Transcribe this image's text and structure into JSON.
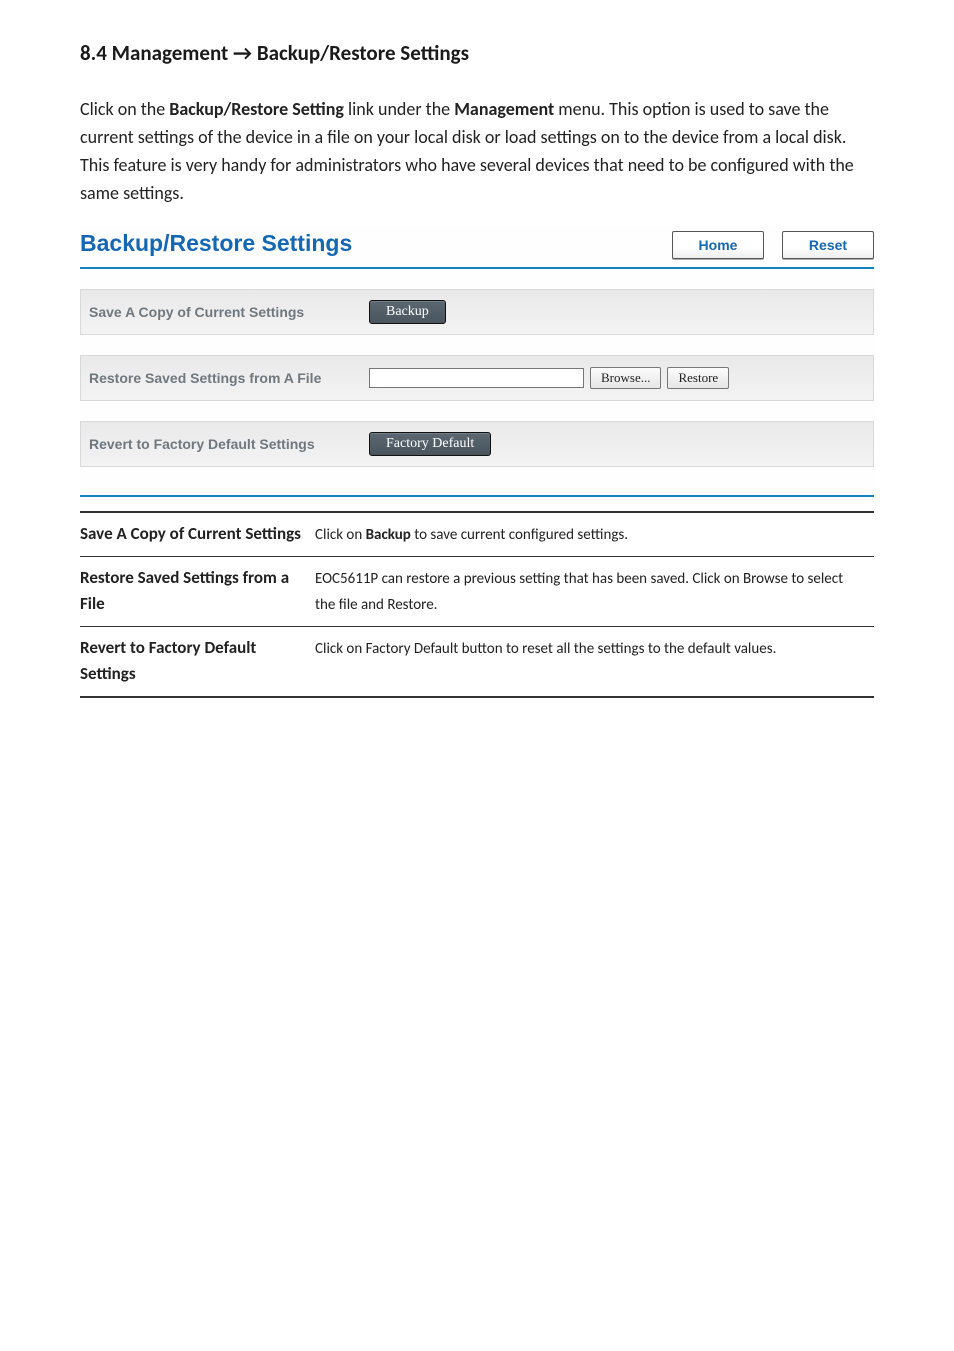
{
  "section_heading": "8.4 Management → Backup/Restore Settings",
  "intro": {
    "pre1": "Click on the ",
    "bold1": "Backup/Restore Setting",
    "mid1": " link under the ",
    "bold2": "Management",
    "post1": " menu. This option is used to save the current settings of the device in a file on your local disk or load settings on to the device from a local disk. This feature is very handy for administrators who have several devices that need to be configured with the same settings."
  },
  "panel": {
    "title": "Backup/Restore Settings",
    "home": "Home",
    "reset": "Reset",
    "row_save_label": "Save A Copy of Current Settings",
    "backup_btn": "Backup",
    "row_restore_label": "Restore Saved Settings from A File",
    "browse_btn": "Browse...",
    "restore_btn": "Restore",
    "row_revert_label": "Revert to Factory Default Settings",
    "factory_btn": "Factory Default"
  },
  "table": {
    "r1_term": "Save A Copy of Current Settings",
    "r1_def_pre": "Click on ",
    "r1_def_bold": "Backup",
    "r1_def_post": " to save current configured settings.",
    "r2_term": "Restore Saved Settings from a File",
    "r2_def": "EOC5611P can restore a previous setting that has been saved. Click on Browse to select the file and Restore.",
    "r3_term": "Revert to Factory Default Settings",
    "r3_def": "Click on Factory Default button to reset all the settings to the default values."
  }
}
